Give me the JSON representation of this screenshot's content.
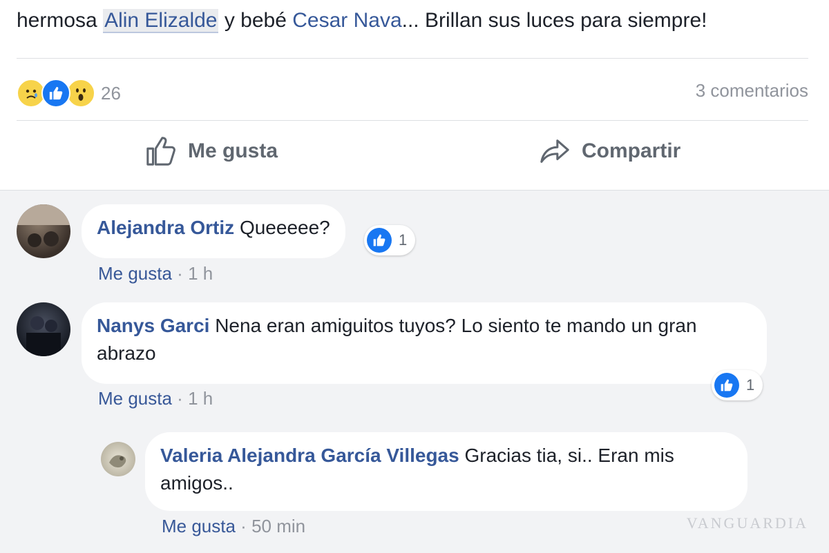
{
  "post": {
    "text_prefix": "hermosa ",
    "mention_1": "Alin Elizalde",
    "text_middle": " y bebé ",
    "mention_2": "Cesar Nava",
    "text_suffix": "... Brillan sus luces para siempre!"
  },
  "reactions": {
    "icons": [
      "sad-face-icon",
      "like-icon",
      "wow-face-icon"
    ],
    "count": "26",
    "comments_count": "3 comentarios"
  },
  "actions": {
    "like_label": "Me gusta",
    "share_label": "Compartir"
  },
  "comments": [
    {
      "author": "Alejandra Ortiz",
      "text": " Queeeee?",
      "like_label": "Me gusta",
      "separator": " · ",
      "time": "1 h",
      "likes": "1"
    },
    {
      "author": "Nanys Garci",
      "text": " Nena eran amiguitos tuyos? Lo siento te mando un gran abrazo",
      "like_label": "Me gusta",
      "separator": " · ",
      "time": "1 h",
      "likes": "1"
    }
  ],
  "reply": {
    "author": "Valeria Alejandra García Villegas",
    "text": " Gracias tia, si.. Eran mis amigos..",
    "like_label": "Me gusta",
    "separator": " · ",
    "time": "50 min"
  },
  "watermark": "VANGUARDIA",
  "colors": {
    "link": "#365899",
    "like_blue": "#1877f2",
    "comment_bg": "#f2f3f5",
    "muted": "#90949c"
  }
}
